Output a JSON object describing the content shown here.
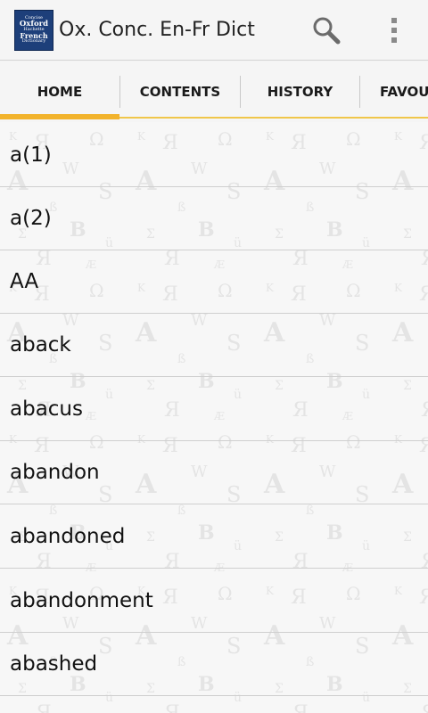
{
  "app": {
    "title": "Ox. Conc. En-Fr Dict",
    "logo": {
      "line1": "Concise",
      "line2": "Oxford",
      "line3": "Hachette",
      "line4": "French",
      "line5": "Dictionary"
    },
    "accent_color": "#f2b32c",
    "logo_color": "#1d3f7a"
  },
  "toolbar": {
    "search_icon": "search-icon",
    "overflow_icon": "more-vertical-icon"
  },
  "tabs": [
    {
      "label": "HOME",
      "selected": true
    },
    {
      "label": "CONTENTS",
      "selected": false
    },
    {
      "label": "HISTORY",
      "selected": false
    },
    {
      "label": "FAVOURITES",
      "selected": false
    }
  ],
  "entries": [
    {
      "word": "a(1)"
    },
    {
      "word": "a(2)"
    },
    {
      "word": "AA"
    },
    {
      "word": "aback"
    },
    {
      "word": "abacus"
    },
    {
      "word": "abandon"
    },
    {
      "word": "abandoned"
    },
    {
      "word": "abandonment"
    },
    {
      "word": "abashed"
    }
  ]
}
